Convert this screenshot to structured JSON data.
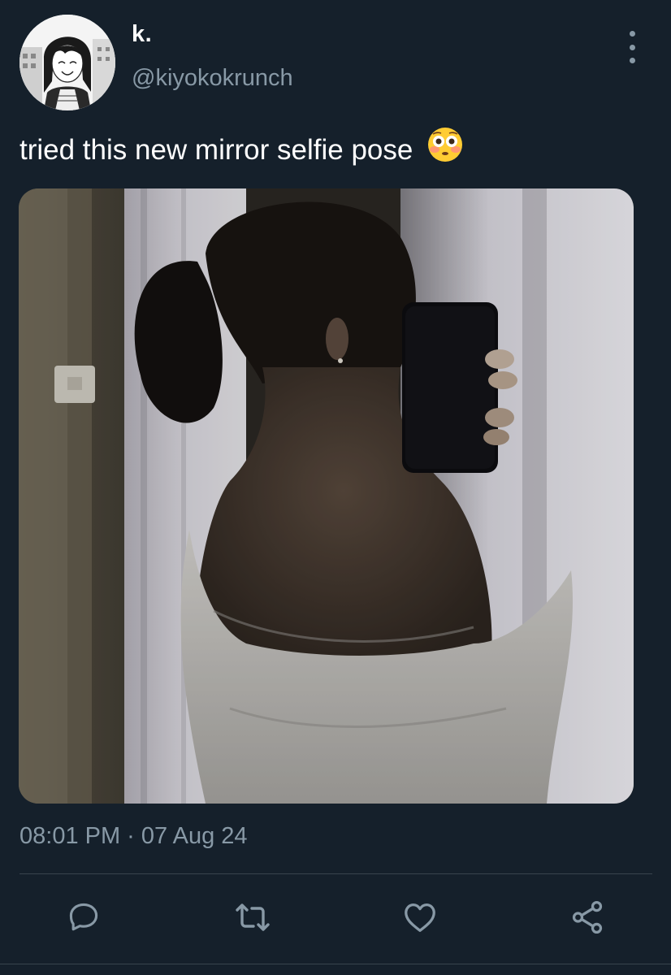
{
  "tweet": {
    "display_name": "k.",
    "handle": "@kiyokokrunch",
    "text": "tried this new mirror selfie pose",
    "emoji": "flushed-face-emoji",
    "timestamp": "08:01 PM · 07 Aug 24"
  },
  "actions": [
    {
      "icon": "reply-icon"
    },
    {
      "icon": "retweet-icon"
    },
    {
      "icon": "like-icon"
    },
    {
      "icon": "share-icon"
    }
  ],
  "colors": {
    "background": "#15202b",
    "primary_text": "#ffffff",
    "secondary_text": "#8899a6",
    "divider": "#38444d"
  }
}
